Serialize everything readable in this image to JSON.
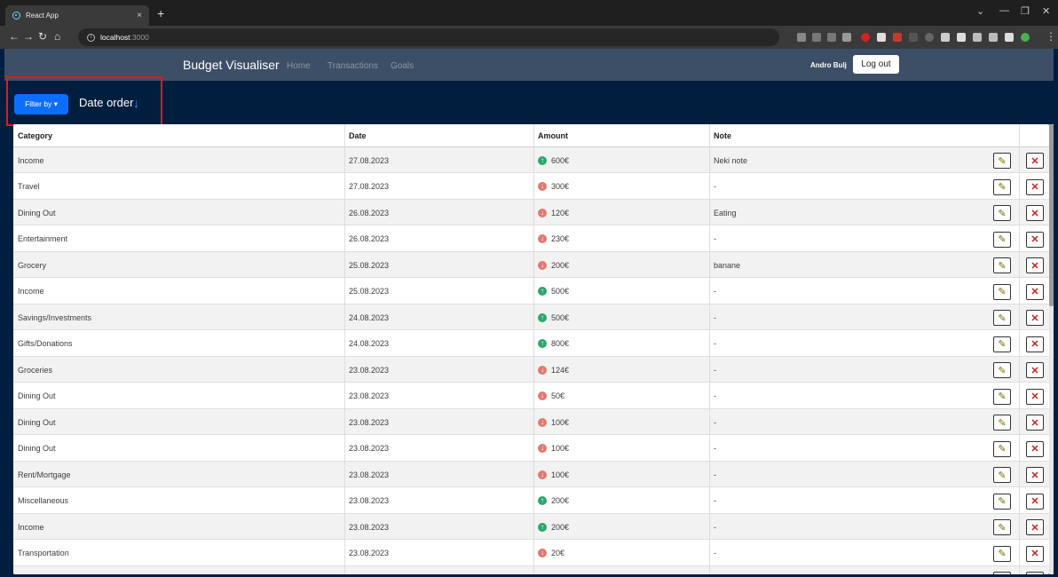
{
  "browser": {
    "tab_title": "React App",
    "tab_close": "×",
    "new_tab": "+",
    "url_host": "localhost",
    "url_port": ":3000",
    "window_controls": [
      "⌄",
      "—",
      "❐",
      "✕"
    ]
  },
  "navbar": {
    "brand": "Budget Visualiser",
    "links": [
      "Home",
      "Transactions",
      "Goals"
    ],
    "username": "Andro Bulj",
    "logout_label": "Log out"
  },
  "filter": {
    "button_label": "Filter by ▾",
    "sort_label": "Date order",
    "sort_arrow": "↓"
  },
  "table": {
    "headers": {
      "category": "Category",
      "date": "Date",
      "amount": "Amount",
      "note": "Note"
    },
    "rows": [
      {
        "category": "Income",
        "date": "27.08.2023",
        "amount": "600€",
        "direction": "up",
        "note": "Neki note"
      },
      {
        "category": "Travel",
        "date": "27.08.2023",
        "amount": "300€",
        "direction": "down",
        "note": "-"
      },
      {
        "category": "Dining Out",
        "date": "26.08.2023",
        "amount": "120€",
        "direction": "down",
        "note": "Eating"
      },
      {
        "category": "Entertainment",
        "date": "26.08.2023",
        "amount": "230€",
        "direction": "down",
        "note": "-"
      },
      {
        "category": "Grocery",
        "date": "25.08.2023",
        "amount": "200€",
        "direction": "down",
        "note": "banane"
      },
      {
        "category": "Income",
        "date": "25.08.2023",
        "amount": "500€",
        "direction": "up",
        "note": "-"
      },
      {
        "category": "Savings/Investments",
        "date": "24.08.2023",
        "amount": "500€",
        "direction": "up",
        "note": "-"
      },
      {
        "category": "Gifts/Donations",
        "date": "24.08.2023",
        "amount": "800€",
        "direction": "up",
        "note": "-"
      },
      {
        "category": "Groceries",
        "date": "23.08.2023",
        "amount": "124€",
        "direction": "down",
        "note": "-"
      },
      {
        "category": "Dining Out",
        "date": "23.08.2023",
        "amount": "50€",
        "direction": "down",
        "note": "-"
      },
      {
        "category": "Dining Out",
        "date": "23.08.2023",
        "amount": "100€",
        "direction": "down",
        "note": "-"
      },
      {
        "category": "Dining Out",
        "date": "23.08.2023",
        "amount": "100€",
        "direction": "down",
        "note": "-"
      },
      {
        "category": "Rent/Mortgage",
        "date": "23.08.2023",
        "amount": "100€",
        "direction": "down",
        "note": "-"
      },
      {
        "category": "Miscellaneous",
        "date": "23.08.2023",
        "amount": "200€",
        "direction": "up",
        "note": "-"
      },
      {
        "category": "Income",
        "date": "23.08.2023",
        "amount": "200€",
        "direction": "up",
        "note": "-"
      },
      {
        "category": "Transportation",
        "date": "23.08.2023",
        "amount": "20€",
        "direction": "down",
        "note": "-"
      }
    ],
    "edit_icon": "pencil-icon",
    "delete_icon": "x-icon"
  },
  "colors": {
    "page_bg": "#001f3f",
    "navbar_bg": "#3d4f67",
    "primary": "#0d6efd",
    "income": "#2aa86a",
    "expense": "#e07a6c",
    "highlight": "#e01b1b"
  }
}
